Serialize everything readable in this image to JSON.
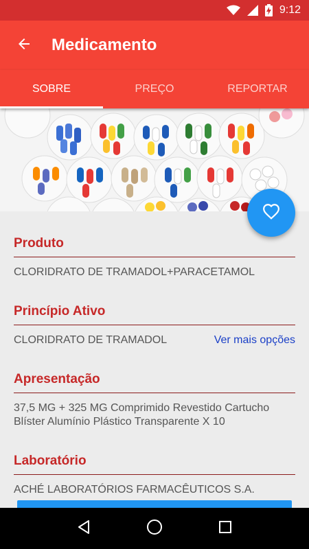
{
  "status_bar": {
    "time": "9:12",
    "icons": [
      "wifi-icon",
      "signal-icon",
      "battery-charging-icon"
    ]
  },
  "app_bar": {
    "title": "Medicamento",
    "back_icon": "arrow-back-icon"
  },
  "tabs": [
    {
      "label": "SOBRE",
      "active": true
    },
    {
      "label": "PREÇO",
      "active": false
    },
    {
      "label": "REPORTAR",
      "active": false
    }
  ],
  "hero": {
    "icon": "pill-cups-photo"
  },
  "fab": {
    "icon": "heart-outline-icon"
  },
  "sections": {
    "produto": {
      "heading": "Produto",
      "value": "CLORIDRATO DE TRAMADOL+PARACETAMOL"
    },
    "principio": {
      "heading": "Princípio Ativo",
      "value": "CLORIDRATO DE TRAMADOL",
      "link": "Ver mais opções"
    },
    "apresentacao": {
      "heading": "Apresentação",
      "value": "37,5 MG + 325 MG Comprimido Revestido Cartucho Blíster Alumínio Plástico Transparente X 10"
    },
    "laboratorio": {
      "heading": "Laboratório",
      "value": "ACHÉ LABORATÓRIOS FARMACÊUTICOS S.A."
    }
  },
  "colors": {
    "primary": "#f44336",
    "primary_dark": "#d32f2f",
    "accent": "#2196f3",
    "heading": "#c62828",
    "link": "#1a3fc7"
  },
  "nav_bar": {
    "icons": [
      "back-triangle-icon",
      "home-circle-icon",
      "recents-square-icon"
    ]
  }
}
